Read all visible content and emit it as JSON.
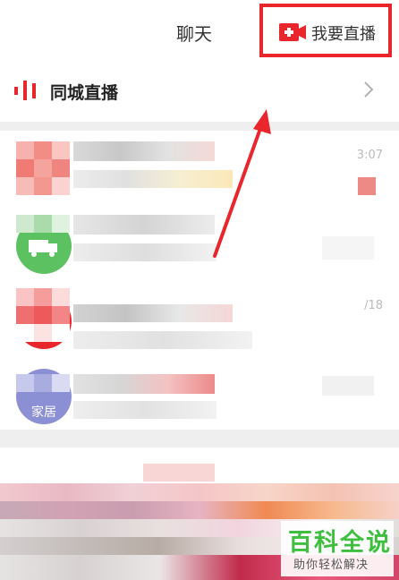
{
  "header": {
    "title": "聊天",
    "go_live_label": "我要直播"
  },
  "local_live": {
    "label": "同城直播"
  },
  "conversations": [
    {
      "name": "",
      "message": "",
      "time": "3:07"
    },
    {
      "name": "",
      "message": "",
      "time": ""
    },
    {
      "name": "",
      "message": "",
      "time": "/18"
    },
    {
      "name": "",
      "message": "",
      "time": "",
      "avatar_text": "家居"
    }
  ],
  "watermark": {
    "title": "百科全说",
    "subtitle": "助你轻松解决"
  },
  "colors": {
    "accent_red": "#e8262c",
    "watermark_green": "#3fbf3f"
  }
}
